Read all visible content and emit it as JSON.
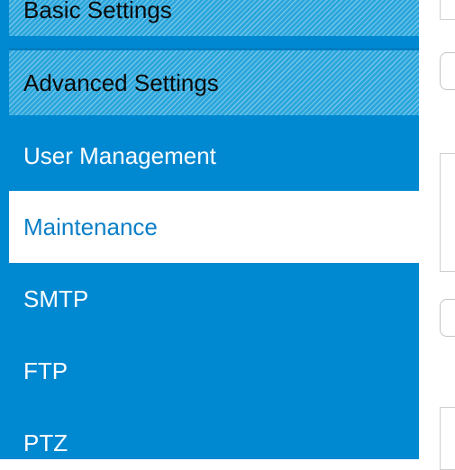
{
  "sidebar": {
    "items": [
      {
        "label": "Basic Settings"
      },
      {
        "label": "Advanced Settings"
      },
      {
        "label": "User Management"
      },
      {
        "label": "Maintenance"
      },
      {
        "label": "SMTP"
      },
      {
        "label": "FTP"
      },
      {
        "label": "PTZ"
      }
    ],
    "active_item": "Maintenance"
  },
  "colors": {
    "sidebar_bg": "#0088d1",
    "active_bg": "#ffffff",
    "active_text": "#0b7fc7",
    "hatched_bg": "#2aa6dc"
  }
}
